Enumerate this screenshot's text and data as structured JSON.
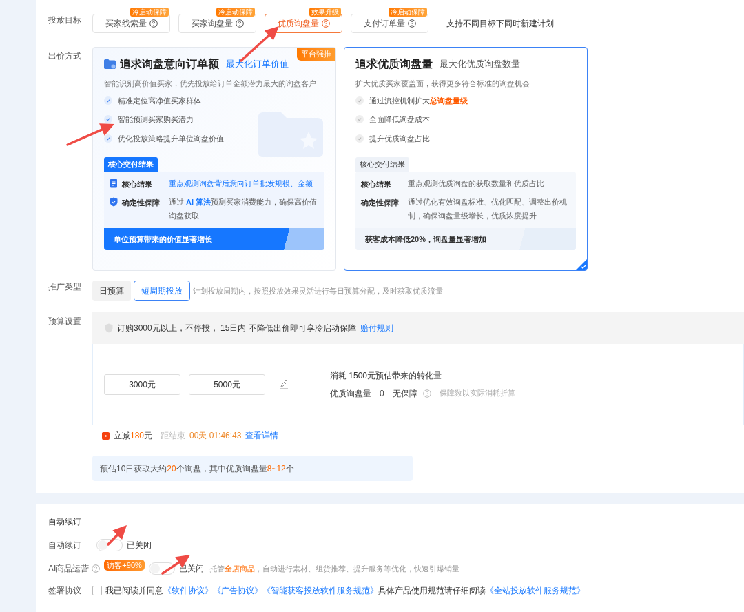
{
  "goal": {
    "label": "投放目标",
    "options": [
      {
        "label": "买家线索量",
        "badge": "冷启动保障",
        "selected": false
      },
      {
        "label": "买家询盘量",
        "badge": "冷启动保障",
        "selected": false
      },
      {
        "label": "优质询盘量",
        "badge": "效果升级",
        "selected": true
      },
      {
        "label": "支付订单量",
        "badge": "冷启动保障",
        "selected": false
      }
    ],
    "note": "支持不同目标下同时新建计划"
  },
  "bid": {
    "label": "出价方式",
    "cards": [
      {
        "featured": true,
        "selected": false,
        "ribbon": "平台强推",
        "title": "追求询盘意向订单额",
        "subtitle": "最大化订单价值",
        "description": "智能识别高价值买家，优先投放给订单金额潜力最大的询盘客户",
        "bullets": [
          [
            {
              "text": "精准定位高净值买家群体",
              "kind": "plain"
            }
          ],
          [
            {
              "text": "智能预测买家购买潜力",
              "kind": "plain"
            }
          ],
          [
            {
              "text": "优化投放策略提升单位询盘价值",
              "kind": "plain"
            }
          ]
        ],
        "result_tag": "核心交付结果",
        "results": [
          {
            "kind": "document",
            "label": "核心结果",
            "text": [
              {
                "text": "重点观测询盘背后意向订单批发规模、金额",
                "kind": "link"
              }
            ]
          },
          {
            "kind": "shield",
            "label": "确定性保障",
            "text": [
              {
                "text": "通过 ",
                "kind": "plain"
              },
              {
                "text": "AI 算法",
                "kind": "strong-link"
              },
              {
                "text": "预测买家消费能力，确保高价值询盘获取",
                "kind": "plain"
              }
            ]
          }
        ],
        "footer": "单位预算带来的价值显著增长"
      },
      {
        "featured": false,
        "selected": true,
        "title": "追求优质询盘量",
        "subtitle": "最大化优质询盘数量",
        "description": "扩大优质买家覆盖面，获得更多符合标准的询盘机会",
        "bullets": [
          [
            {
              "text": "通过流控机制扩大",
              "kind": "plain"
            },
            {
              "text": "总询盘量级",
              "kind": "strong-accent"
            }
          ],
          [
            {
              "text": "全面降低询盘成本",
              "kind": "plain"
            }
          ],
          [
            {
              "text": "提升优质询盘占比",
              "kind": "plain"
            }
          ]
        ],
        "result_tag": "核心交付结果",
        "results": [
          {
            "kind": "none",
            "label": "核心结果",
            "text": [
              {
                "text": "重点观测优质询盘的获取数量和优质占比",
                "kind": "plain"
              }
            ]
          },
          {
            "kind": "none",
            "label": "确定性保障",
            "text": [
              {
                "text": "通过优化有效询盘标准、优化匹配、调整出价机制，确保询盘量级增长，优质浓度提升",
                "kind": "plain"
              }
            ]
          }
        ],
        "footer": "获客成本降低20%，询盘量显著增加"
      }
    ]
  },
  "promo_type": {
    "label": "推广类型",
    "options": [
      {
        "label": "日预算",
        "selected": false
      },
      {
        "label": "短周期投放",
        "selected": true
      }
    ],
    "hint": "计划投放周期内，按照投放效果灵活进行每日预算分配，及时获取优质流量"
  },
  "budget": {
    "label": "预算设置",
    "notice": "订购3000元以上，不停投， 15日内 不降低出价即可享冷启动保障",
    "notice_link": "赔付规则",
    "amounts": [
      "3000元",
      "5000元"
    ],
    "estimate_title": "消耗 1500元预估带来的转化量",
    "metric_label": "优质询盘量",
    "metric_value": "0",
    "guarantee": "无保障",
    "guarantee_hint": "保障数以实际消耗折算",
    "discount": [
      {
        "text": "立减",
        "kind": "plain"
      },
      {
        "text": "180",
        "kind": "accent"
      },
      {
        "text": "元",
        "kind": "plain"
      }
    ],
    "countdown_label": "距结束",
    "countdown": "00天 01:46:43",
    "details_link": "查看详情",
    "estimate": [
      {
        "text": "预估10日获取大约",
        "kind": "plain"
      },
      {
        "text": "20",
        "kind": "accent"
      },
      {
        "text": "个询盘，其中优质询盘量",
        "kind": "plain"
      },
      {
        "text": "8~12",
        "kind": "accent"
      },
      {
        "text": "个",
        "kind": "plain"
      }
    ]
  },
  "renewal": {
    "title": "自动续订",
    "rows": [
      {
        "kind": "toggle",
        "label": "自动续订",
        "on": false,
        "status": "已关闭"
      },
      {
        "kind": "toggle",
        "label": "AI商品运营",
        "help": true,
        "badge": "访客+90%",
        "on": false,
        "status": "已关闭",
        "hint": [
          {
            "text": "托管",
            "kind": "muted"
          },
          {
            "text": "全店商品",
            "kind": "accent"
          },
          {
            "text": "，自动进行素材、组货推荐、提升服务等优化，快速引爆销量",
            "kind": "muted"
          }
        ]
      },
      {
        "kind": "agreement",
        "label": "签署协议",
        "checked": false,
        "text": [
          {
            "text": "我已阅读并同意",
            "kind": "plain"
          },
          {
            "text": "《软件协议》",
            "kind": "link"
          },
          {
            "text": "《广告协议》",
            "kind": "link"
          },
          {
            "text": "《智能获客投放软件服务规范》",
            "kind": "link"
          },
          {
            "text": "具体产品使用规范请仔细阅读",
            "kind": "plain"
          },
          {
            "text": "《全站投放软件服务规范》",
            "kind": "link"
          }
        ]
      }
    ]
  }
}
